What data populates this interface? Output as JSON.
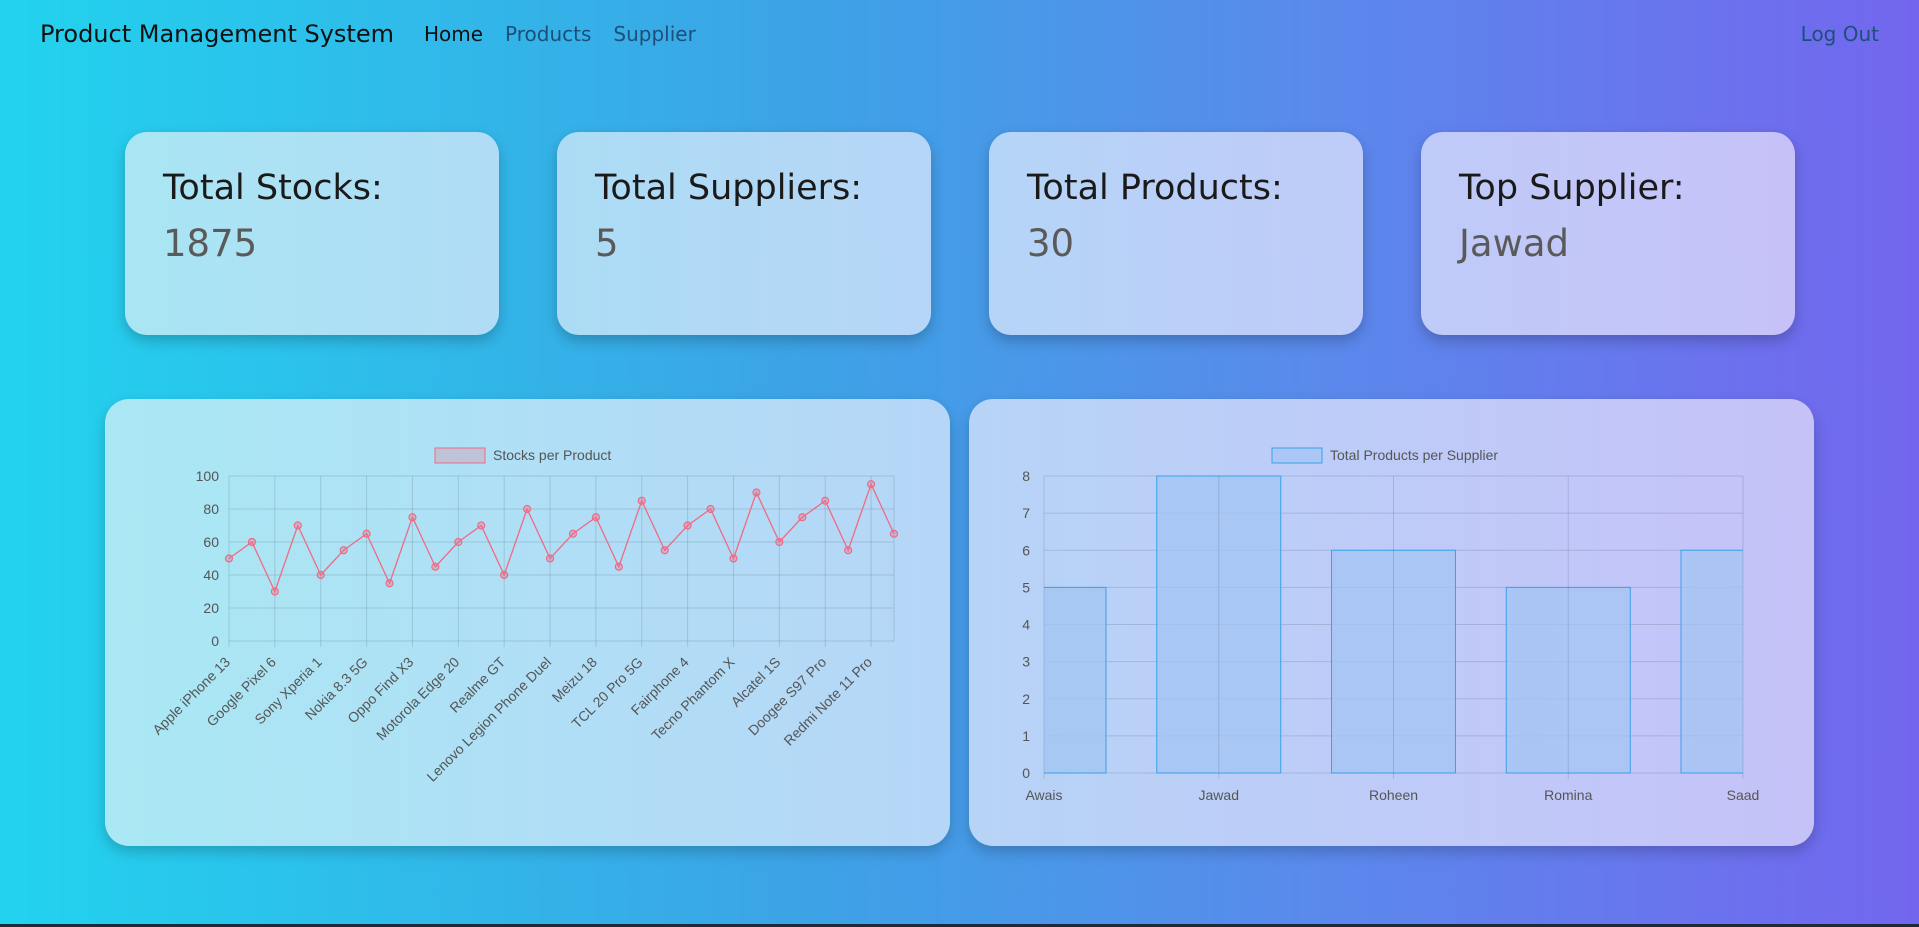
{
  "nav": {
    "brand": "Product Management System",
    "links": [
      "Home",
      "Products",
      "Supplier"
    ],
    "logout": "Log Out"
  },
  "cards": [
    {
      "label": "Total Stocks:",
      "value": "1875"
    },
    {
      "label": "Total Suppliers:",
      "value": "5"
    },
    {
      "label": "Total Products:",
      "value": "30"
    },
    {
      "label": "Top Supplier:",
      "value": "Jawad"
    }
  ],
  "colors": {
    "line": "#f06a85",
    "bar_fill": "#a3c4f3",
    "bar_stroke": "#3aa0e8"
  },
  "chart_data": [
    {
      "type": "line",
      "legend": "Stocks per Product",
      "ylim": [
        0,
        100
      ],
      "yticks": [
        0,
        20,
        40,
        60,
        80,
        100
      ],
      "x_tick_labels": [
        "Apple iPhone 13",
        "Google Pixel 6",
        "Sony Xperia 1",
        "Nokia 8.3 5G",
        "Oppo Find X3",
        "Motorola Edge 20",
        "Realme GT",
        "Lenovo Legion Phone Duel",
        "Meizu 18",
        "TCL 20 Pro 5G",
        "Fairphone 4",
        "Tecno Phantom X",
        "Alcatel 1S",
        "Doogee S97 Pro",
        "Redmi Note 11 Pro"
      ],
      "values": [
        50,
        60,
        30,
        70,
        40,
        55,
        65,
        35,
        75,
        45,
        60,
        70,
        40,
        80,
        50,
        65,
        75,
        45,
        85,
        55,
        70,
        80,
        50,
        90,
        60,
        75,
        85,
        55,
        95,
        65
      ],
      "grid": true
    },
    {
      "type": "bar",
      "legend": "Total Products per Supplier",
      "categories": [
        "Awais",
        "Jawad",
        "Roheen",
        "Romina",
        "Saad"
      ],
      "values": [
        5,
        8,
        6,
        5,
        6
      ],
      "ylim": [
        0,
        8
      ],
      "yticks": [
        0,
        1,
        2,
        3,
        4,
        5,
        6,
        7,
        8
      ],
      "grid": true
    }
  ]
}
